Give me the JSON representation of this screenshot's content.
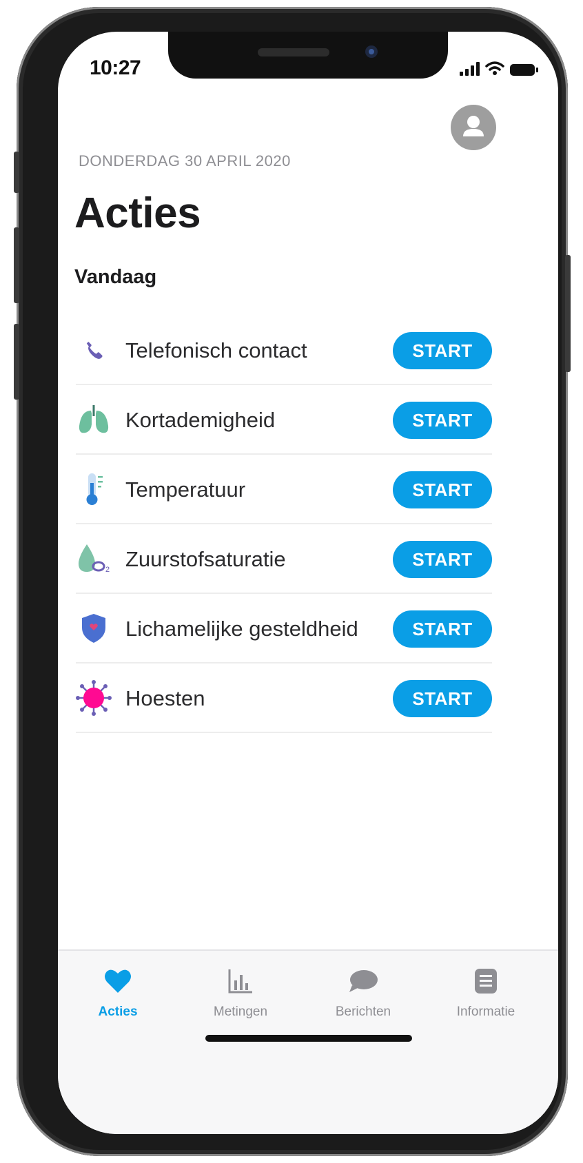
{
  "status_bar": {
    "time": "10:27"
  },
  "header": {
    "date": "DONDERDAG 30 APRIL 2020",
    "title": "Acties",
    "section": "Vandaag"
  },
  "actions": [
    {
      "label": "Telefonisch contact",
      "icon": "phone-icon",
      "button": "START"
    },
    {
      "label": "Kortademigheid",
      "icon": "lungs-icon",
      "button": "START"
    },
    {
      "label": "Temperatuur",
      "icon": "thermometer-icon",
      "button": "START"
    },
    {
      "label": "Zuurstofsaturatie",
      "icon": "oxygen-drop-icon",
      "button": "START"
    },
    {
      "label": "Lichamelijke gesteldheid",
      "icon": "shield-heart-icon",
      "button": "START"
    },
    {
      "label": "Hoesten",
      "icon": "virus-icon",
      "button": "START"
    }
  ],
  "tabs": [
    {
      "label": "Acties",
      "icon": "heart-icon",
      "active": true
    },
    {
      "label": "Metingen",
      "icon": "bar-chart-icon",
      "active": false
    },
    {
      "label": "Berichten",
      "icon": "chat-bubble-icon",
      "active": false
    },
    {
      "label": "Informatie",
      "icon": "document-icon",
      "active": false
    }
  ],
  "colors": {
    "accent": "#0a9ee6",
    "phone_icon": "#6b5fb5",
    "lungs": "#6dbf9e",
    "thermometer": "#2a7fd4",
    "oxygen": "#7fc3a8",
    "shield": "#4a6fd0",
    "virus": "#ff0a92"
  }
}
